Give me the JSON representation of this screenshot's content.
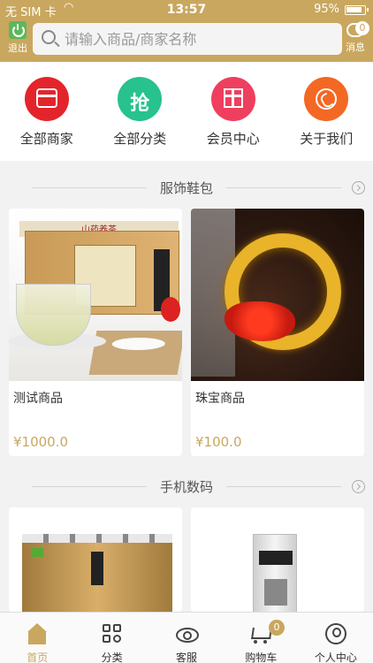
{
  "status_bar": {
    "carrier": "无 SIM 卡",
    "time": "13:57",
    "battery": "95%"
  },
  "header": {
    "logout_label": "退出",
    "search_placeholder": "请输入商品/商家名称",
    "message_label": "消息",
    "message_count": "0"
  },
  "categories": [
    {
      "label": "全部商家",
      "icon": "store-icon",
      "color": "#e4242b"
    },
    {
      "label": "全部分类",
      "icon": "grab-icon",
      "glyph": "抢",
      "color": "#27c28e"
    },
    {
      "label": "会员中心",
      "icon": "gift-icon",
      "color": "#ef3f5e"
    },
    {
      "label": "关于我们",
      "icon": "phone-icon",
      "color": "#f36823"
    }
  ],
  "sections": [
    {
      "title": "服饰鞋包",
      "products": [
        {
          "name": "测试商品",
          "price": "¥1000.0",
          "image": "tea-gift-box"
        },
        {
          "name": "珠宝商品",
          "price": "¥100.0",
          "image": "citrine-bracelet"
        }
      ]
    },
    {
      "title": "手机数码",
      "products": [
        {
          "name": "",
          "price": "",
          "image": "water-purifier"
        },
        {
          "name": "",
          "price": "",
          "image": "water-dispenser"
        }
      ]
    }
  ],
  "tea_box_text": "山药养茶",
  "tabbar": {
    "items": [
      {
        "label": "首页",
        "icon": "home-icon",
        "active": true
      },
      {
        "label": "分类",
        "icon": "category-grid-icon",
        "active": false
      },
      {
        "label": "客服",
        "icon": "eye-icon",
        "active": false
      },
      {
        "label": "购物车",
        "icon": "cart-icon",
        "active": false
      },
      {
        "label": "个人中心",
        "icon": "user-icon",
        "active": false
      }
    ],
    "cart_count": "0"
  },
  "colors": {
    "brand_gold": "#c9a75e",
    "background": "#f2f2f2"
  }
}
